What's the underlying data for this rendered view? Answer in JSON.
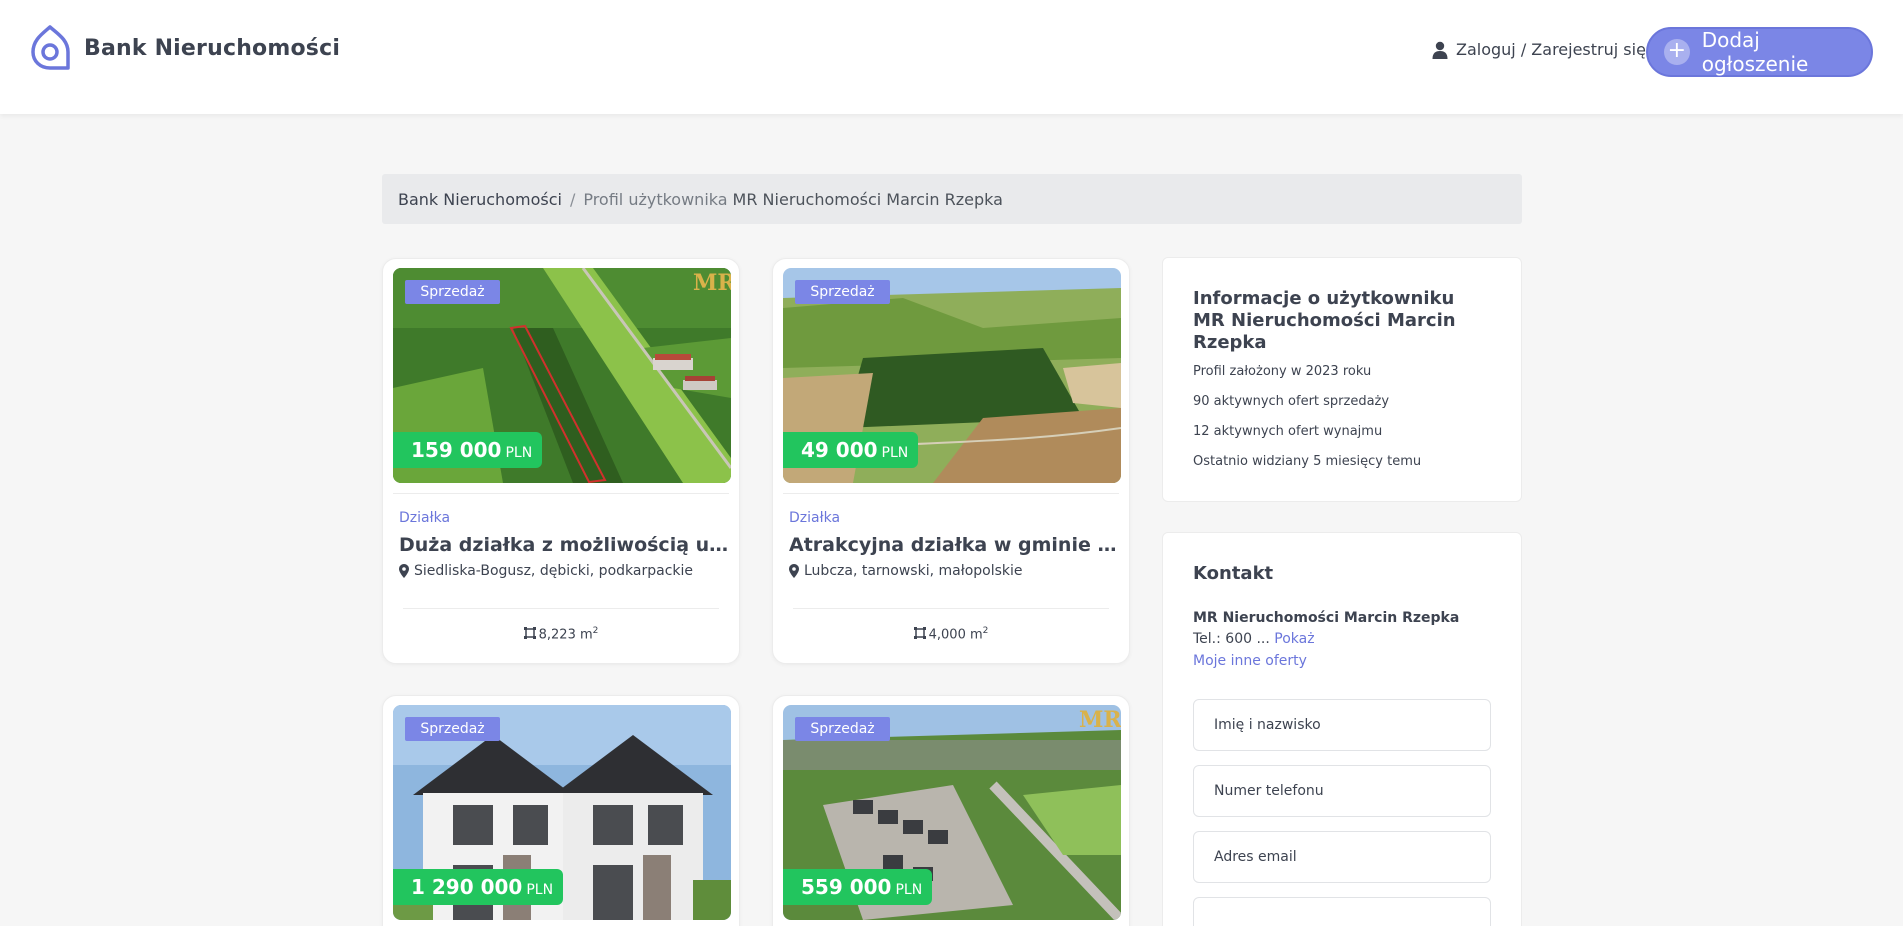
{
  "header": {
    "brand": "Bank Nieruchomości",
    "login_label": "Zaloguj / Zarejestruj się",
    "add_button_label": "Dodaj ogłoszenie"
  },
  "breadcrumb": {
    "home": "Bank Nieruchomości",
    "separator": "/",
    "section": "Profil użytkownika",
    "current": "MR Nieruchomości Marcin Rzepka"
  },
  "listings": [
    {
      "badge": "Sprzedaż",
      "price": "159 000",
      "currency": "PLN",
      "category": "Działka",
      "title": "Duża działka z możliwością uzyska...",
      "location": "Siedliska-Bogusz, dębicki, podkarpackie",
      "area": "8,223 m",
      "area_sup": "2"
    },
    {
      "badge": "Sprzedaż",
      "price": "49 000",
      "currency": "PLN",
      "category": "Działka",
      "title": "Atrakcyjna działka w gminie Ryglice",
      "location": "Lubcza, tarnowski, małopolskie",
      "area": "4,000 m",
      "area_sup": "2"
    },
    {
      "badge": "Sprzedaż",
      "price": "1 290 000",
      "currency": "PLN"
    },
    {
      "badge": "Sprzedaż",
      "price": "559 000",
      "currency": "PLN"
    }
  ],
  "info": {
    "title": "Informacje o użytkowniku MR Nieruchomości Marcin Rzepka",
    "since": "Profil założony w 2023 roku",
    "sale_offers": "90 aktywnych ofert sprzedaży",
    "rent_offers": "12 aktywnych ofert wynajmu",
    "last_seen": "Ostatnio widziany 5 miesięcy temu"
  },
  "contact": {
    "title": "Kontakt",
    "name": "MR Nieruchomości Marcin Rzepka",
    "tel_prefix": "Tel.: 600 ...",
    "show_label": "Pokaż",
    "other_offers": "Moje inne oferty",
    "name_placeholder": "Imię i nazwisko",
    "phone_placeholder": "Numer telefonu",
    "email_placeholder": "Adres email"
  },
  "colors": {
    "accent": "#7b86e6",
    "price_green": "#22c55e",
    "link": "#6b76db"
  }
}
